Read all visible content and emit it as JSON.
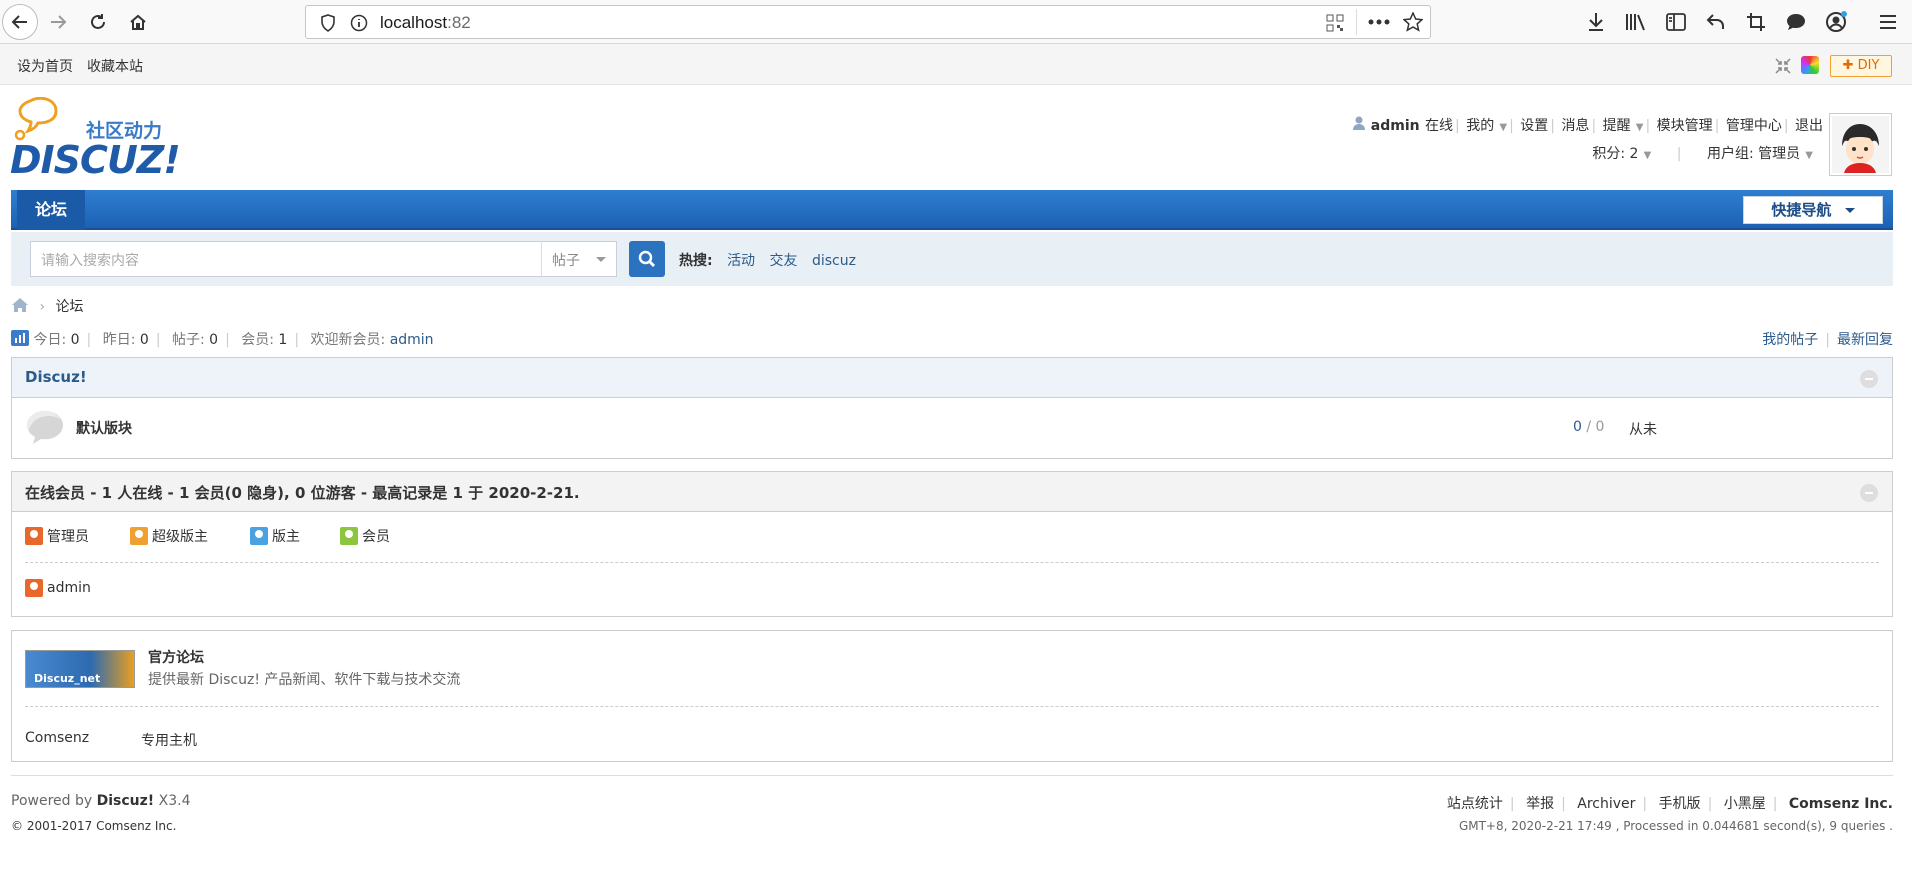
{
  "browser": {
    "url_host": "localhost",
    "url_port": ":82"
  },
  "topbar": {
    "set_home": "设为首页",
    "bookmark": "收藏本站",
    "diy": "✚ DIY"
  },
  "logo": {
    "tagline": "社区动力",
    "brand": "DISCUZ!"
  },
  "user": {
    "name": "admin",
    "status": "在线",
    "mine": "我的",
    "settings": "设置",
    "messages": "消息",
    "remind": "提醒",
    "modules": "模块管理",
    "admin_center": "管理中心",
    "logout": "退出",
    "points": "积分: 2",
    "group": "用户组: 管理员"
  },
  "nav": {
    "forum_tab": "论坛",
    "quick_nav": "快捷导航"
  },
  "search": {
    "placeholder": "请输入搜索内容",
    "type": "帖子",
    "hot_label": "热搜:",
    "hot": [
      "活动",
      "交友",
      "discuz"
    ]
  },
  "breadcrumb": {
    "current": "论坛"
  },
  "stats": {
    "today_label": "今日:",
    "today": "0",
    "yesterday_label": "昨日:",
    "yesterday": "0",
    "posts_label": "帖子:",
    "posts": "0",
    "members_label": "会员:",
    "members": "1",
    "welcome_label": "欢迎新会员:",
    "newest": "admin",
    "my_posts": "我的帖子",
    "latest_replies": "最新回复"
  },
  "category": {
    "title": "Discuz!",
    "forum_name": "默认版块",
    "threads": "0",
    "slash": " / ",
    "replies": "0",
    "last_post": "从未"
  },
  "online": {
    "title": "在线会员 - 1 人在线 - 1 会员(0 隐身), 0 位游客 - 最高记录是 1 于 2020-2-21.",
    "legend": [
      {
        "label": "管理员",
        "color": "#e8672a"
      },
      {
        "label": "超级版主",
        "color": "#f0a030"
      },
      {
        "label": "版主",
        "color": "#4aa2e0"
      },
      {
        "label": "会员",
        "color": "#8cc63f"
      }
    ],
    "user": "admin"
  },
  "links": {
    "banner_text": "Discuz_net",
    "title": "官方论坛",
    "desc": "提供最新 Discuz! 产品新闻、软件下载与技术交流",
    "link1": "Comsenz",
    "link2": "专用主机"
  },
  "footer": {
    "powered": "Powered by",
    "brand": "Discuz!",
    "version": "X3.4",
    "copyright_prefix": "© 2001-2017",
    "company": "Comsenz Inc.",
    "links": [
      "站点统计",
      "举报",
      "Archiver",
      "手机版",
      "小黑屋"
    ],
    "company_bold": "Comsenz Inc.",
    "gmt": "GMT+8, 2020-2-21 17:49 , Processed in 0.044681 second(s), 9 queries ."
  }
}
